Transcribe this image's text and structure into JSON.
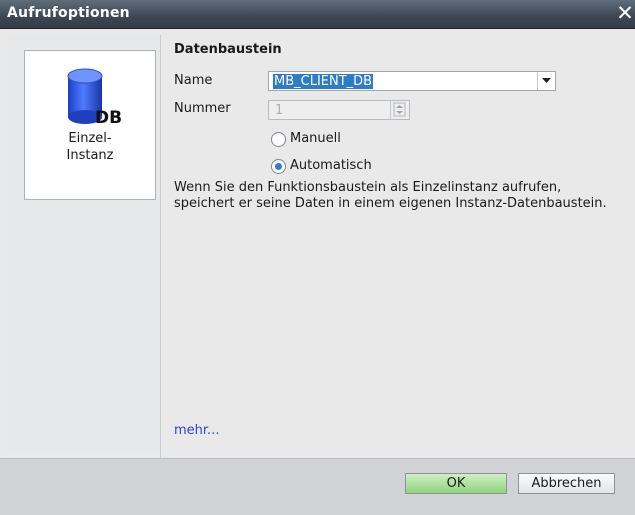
{
  "dialog": {
    "title": "Aufrufoptionen",
    "close_label": "✕"
  },
  "tile": {
    "icon_text": "DB",
    "label": "Einzel-\nInstanz"
  },
  "datablock": {
    "section_title": "Datenbaustein",
    "name_label": "Name",
    "name_value": "MB_CLIENT_DB",
    "number_label": "Nummer",
    "number_value": "1",
    "radio_manual": "Manuell",
    "radio_auto": "Automatisch",
    "selected_mode": "Automatisch",
    "description": "Wenn Sie den Funktionsbaustein als Einzelinstanz aufrufen, speichert er seine Daten in einem eigenen Instanz-Datenbaustein.",
    "more_link": "mehr..."
  },
  "footer": {
    "ok_label": "OK",
    "cancel_label": "Abbrechen"
  },
  "colors": {
    "titlebar": "#3f4a57",
    "selection": "#2d7cc8",
    "link": "#2a46d3",
    "ok_button": "#8fd47d",
    "db_icon": "#2f5fe0"
  }
}
